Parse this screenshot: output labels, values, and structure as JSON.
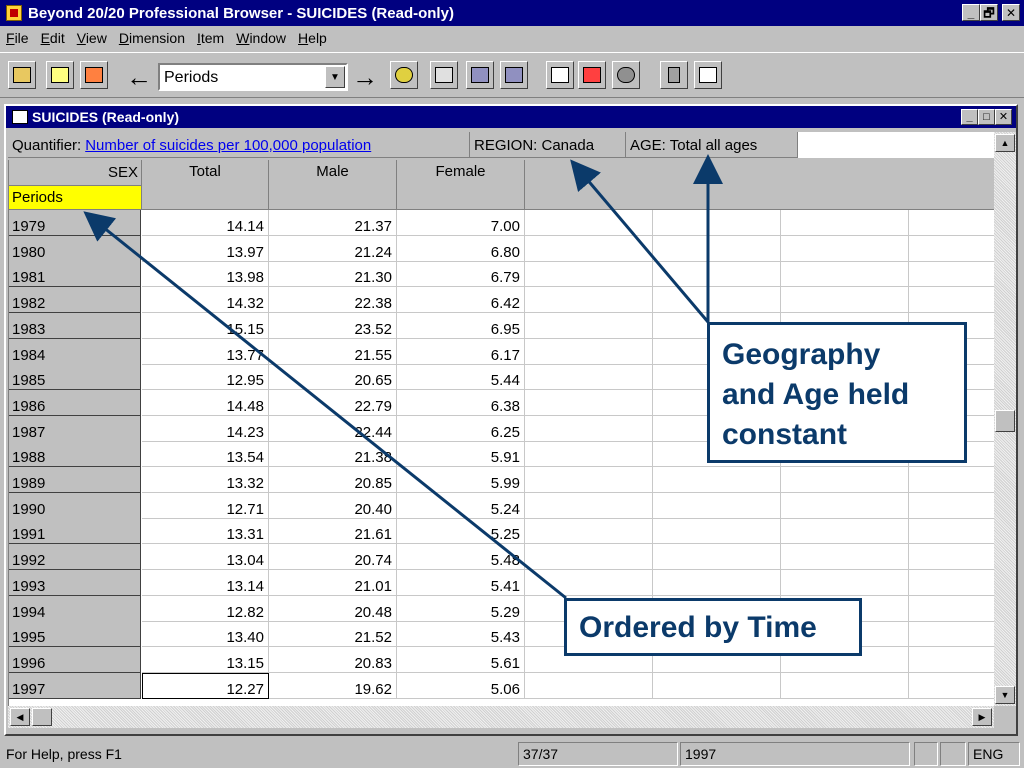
{
  "window": {
    "title": "Beyond 20/20 Professional Browser - SUICIDES (Read-only)",
    "caption_buttons": [
      "_",
      "🗗",
      "✕"
    ]
  },
  "menu": [
    {
      "key": "F",
      "rest": "ile"
    },
    {
      "key": "E",
      "rest": "dit"
    },
    {
      "key": "V",
      "rest": "iew"
    },
    {
      "key": "D",
      "rest": "imension"
    },
    {
      "key": "I",
      "rest": "tem"
    },
    {
      "key": "W",
      "rest": "indow"
    },
    {
      "key": "H",
      "rest": "elp"
    }
  ],
  "toolbar": {
    "dimension_combo_value": "Periods",
    "back_glyph": "←",
    "forward_glyph": "→"
  },
  "child": {
    "title": "SUICIDES (Read-only)",
    "caption_buttons": [
      "_",
      "□",
      "✕"
    ]
  },
  "dims": {
    "quantifier_label": "Quantifier:",
    "quantifier_link": "Number of suicides per 100,000 population",
    "region": "REGION: Canada",
    "age": "AGE: Total all ages"
  },
  "table": {
    "corner_col": "SEX",
    "corner_row": "Periods",
    "columns": [
      "Total",
      "Male",
      "Female"
    ],
    "rows": [
      {
        "period": "1979",
        "values": [
          "14.14",
          "21.37",
          "7.00"
        ]
      },
      {
        "period": "1980",
        "values": [
          "13.97",
          "21.24",
          "6.80"
        ]
      },
      {
        "period": "1981",
        "values": [
          "13.98",
          "21.30",
          "6.79"
        ]
      },
      {
        "period": "1982",
        "values": [
          "14.32",
          "22.38",
          "6.42"
        ]
      },
      {
        "period": "1983",
        "values": [
          "15.15",
          "23.52",
          "6.95"
        ]
      },
      {
        "period": "1984",
        "values": [
          "13.77",
          "21.55",
          "6.17"
        ]
      },
      {
        "period": "1985",
        "values": [
          "12.95",
          "20.65",
          "5.44"
        ]
      },
      {
        "period": "1986",
        "values": [
          "14.48",
          "22.79",
          "6.38"
        ]
      },
      {
        "period": "1987",
        "values": [
          "14.23",
          "22.44",
          "6.25"
        ]
      },
      {
        "period": "1988",
        "values": [
          "13.54",
          "21.38",
          "5.91"
        ]
      },
      {
        "period": "1989",
        "values": [
          "13.32",
          "20.85",
          "5.99"
        ]
      },
      {
        "period": "1990",
        "values": [
          "12.71",
          "20.40",
          "5.24"
        ]
      },
      {
        "period": "1991",
        "values": [
          "13.31",
          "21.61",
          "5.25"
        ]
      },
      {
        "period": "1992",
        "values": [
          "13.04",
          "20.74",
          "5.48"
        ]
      },
      {
        "period": "1993",
        "values": [
          "13.14",
          "21.01",
          "5.41"
        ]
      },
      {
        "period": "1994",
        "values": [
          "12.82",
          "20.48",
          "5.29"
        ]
      },
      {
        "period": "1995",
        "values": [
          "13.40",
          "21.52",
          "5.43"
        ]
      },
      {
        "period": "1996",
        "values": [
          "13.15",
          "20.83",
          "5.61"
        ]
      },
      {
        "period": "1997",
        "values": [
          "12.27",
          "19.62",
          "5.06"
        ]
      }
    ]
  },
  "status": {
    "help": "For Help, press F1",
    "position": "37/37",
    "current_period": "1997",
    "lang": "ENG"
  },
  "annotations": {
    "geo_age": [
      "Geography",
      "and Age held",
      "constant"
    ],
    "time": "Ordered by Time",
    "color": "#0b3a6a"
  }
}
